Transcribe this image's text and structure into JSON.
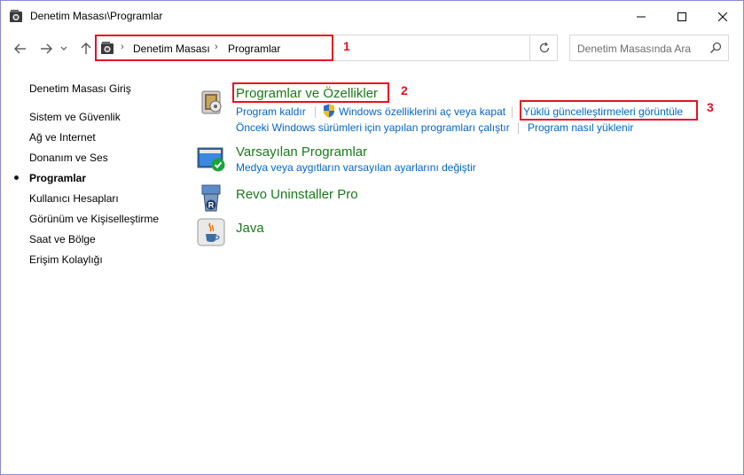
{
  "window": {
    "title": "Denetim Masası\\Programlar"
  },
  "address": {
    "crumbs": [
      "Denetim Masası",
      "Programlar"
    ],
    "separator": "›"
  },
  "search": {
    "placeholder": "Denetim Masasında Ara"
  },
  "sidebar": {
    "items": [
      {
        "label": "Denetim Masası Giriş"
      },
      {
        "label": "Sistem ve Güvenlik"
      },
      {
        "label": "Ağ ve Internet"
      },
      {
        "label": "Donanım ve Ses"
      },
      {
        "label": "Programlar"
      },
      {
        "label": "Kullanıcı Hesapları"
      },
      {
        "label": "Görünüm ve Kişiselleştirme"
      },
      {
        "label": "Saat ve Bölge"
      },
      {
        "label": "Erişim Kolaylığı"
      }
    ]
  },
  "categories": {
    "programs_features": {
      "title": "Programlar ve Özellikler",
      "links": [
        "Program kaldır",
        "Windows özelliklerini aç veya kapat",
        "Yüklü güncelleştirmeleri görüntüle",
        "Önceki Windows sürümleri için yapılan programları çalıştır",
        "Program nasıl yüklenir"
      ]
    },
    "default_programs": {
      "title": "Varsayılan Programlar",
      "links": [
        "Medya veya aygıtların varsayılan ayarlarını değiştir"
      ]
    },
    "revo": {
      "title": "Revo Uninstaller Pro"
    },
    "java": {
      "title": "Java"
    }
  },
  "annotations": {
    "n1": "1",
    "n2": "2",
    "n3": "3"
  },
  "colors": {
    "annotation": "#e81123",
    "link": "#0066cc",
    "category_title": "#1a7a1a"
  }
}
